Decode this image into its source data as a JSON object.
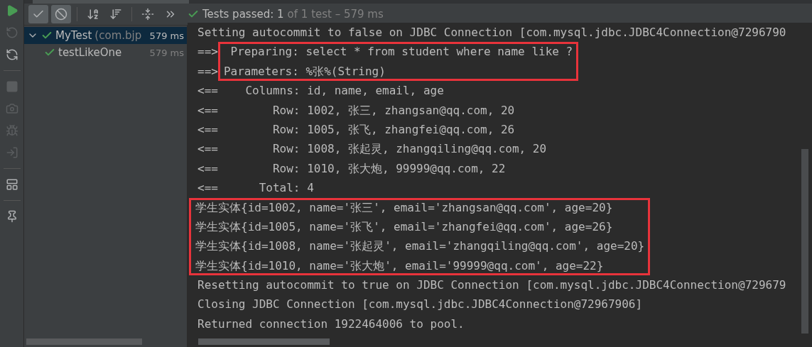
{
  "side_toolbar": [
    {
      "kind": "run",
      "disabled": false
    },
    {
      "kind": "rerun-failed",
      "disabled": true
    },
    {
      "kind": "auto-test",
      "disabled": false
    },
    {
      "kind": "separator"
    },
    {
      "kind": "stop",
      "disabled": true
    },
    {
      "kind": "snapshot",
      "disabled": true
    },
    {
      "kind": "debug-export",
      "disabled": true
    },
    {
      "kind": "import",
      "disabled": true
    },
    {
      "kind": "separator"
    },
    {
      "kind": "layout",
      "disabled": false
    },
    {
      "kind": "separator"
    },
    {
      "kind": "pin",
      "disabled": false
    }
  ],
  "toolbar": [
    {
      "kind": "show-passed",
      "selected": true
    },
    {
      "kind": "show-ignored",
      "selected": true
    },
    {
      "kind": "separator"
    },
    {
      "kind": "sort-alpha",
      "selected": false
    },
    {
      "kind": "sort-duration",
      "selected": false
    },
    {
      "kind": "separator"
    },
    {
      "kind": "expand-collapse",
      "selected": false
    },
    {
      "kind": "more",
      "selected": false
    }
  ],
  "status": {
    "passed": true,
    "summary": "Tests passed: 1",
    "detail": "of 1 test – 579 ms"
  },
  "tree": [
    {
      "label": "MyTest",
      "detail": "(com.bjp",
      "time": "579 ms",
      "passed": true,
      "expanded": true,
      "selected": true,
      "children": [
        {
          "label": "testLikeOne",
          "time": "579 ms",
          "passed": true,
          "selected": false
        }
      ]
    }
  ],
  "console": [
    {
      "boxed": false,
      "lines": [
        {
          "text": "Setting autocommit to false on JDBC Connection [com.mysql.jdbc.JDBC4Connection@7296790"
        }
      ]
    },
    {
      "boxed": true,
      "lines": [
        {
          "prefix": "==>",
          "text": " Preparing: select * from student where name like ?"
        },
        {
          "prefix": "==>",
          "text": "Parameters: %张%(String)"
        }
      ]
    },
    {
      "boxed": false,
      "lines": [
        {
          "text": "<==    Columns: id, name, email, age"
        },
        {
          "text": "<==        Row: 1002, 张三, zhangsan@qq.com, 20"
        },
        {
          "text": "<==        Row: 1005, 张飞, zhangfei@qq.com, 26"
        },
        {
          "text": "<==        Row: 1008, 张起灵, zhangqiling@qq.com, 20"
        },
        {
          "text": "<==        Row: 1010, 张大炮, 99999@qq.com, 22"
        },
        {
          "text": "<==      Total: 4"
        }
      ]
    },
    {
      "boxed": true,
      "lines": [
        {
          "text": "学生实体{id=1002, name='张三', email='zhangsan@qq.com', age=20}"
        },
        {
          "text": "学生实体{id=1005, name='张飞', email='zhangfei@qq.com', age=26}"
        },
        {
          "text": "学生实体{id=1008, name='张起灵', email='zhangqiling@qq.com', age=20}"
        },
        {
          "text": "学生实体{id=1010, name='张大炮', email='99999@qq.com', age=22}"
        }
      ]
    },
    {
      "boxed": false,
      "lines": [
        {
          "text": "Resetting autocommit to true on JDBC Connection [com.mysql.jdbc.JDBC4Connection@729679"
        },
        {
          "text": "Closing JDBC Connection [com.mysql.jdbc.JDBC4Connection@72967906]"
        },
        {
          "text": "Returned connection 1922464006 to pool."
        }
      ]
    }
  ]
}
